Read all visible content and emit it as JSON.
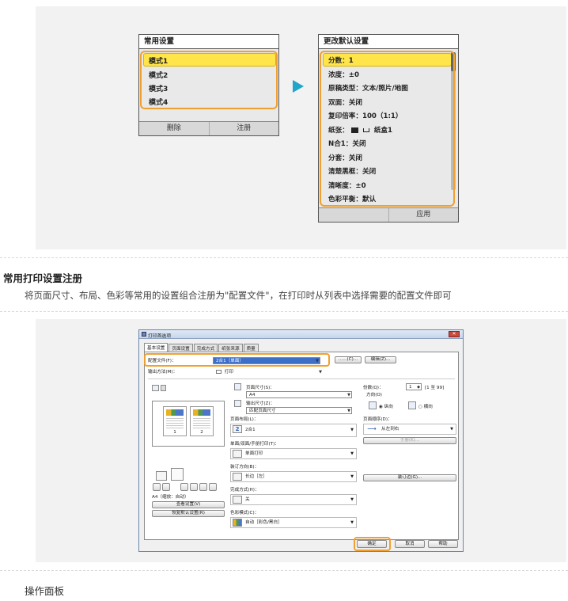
{
  "favorites_screen": {
    "title": "常用设置",
    "items": [
      "模式1",
      "模式2",
      "模式3",
      "模式4"
    ],
    "delete_label": "删除",
    "register_label": "注册"
  },
  "defaults_screen": {
    "title": "更改默认设置",
    "items": [
      "分数：1",
      "浓度：±0",
      "原稿类型：文本/照片/地图",
      "双面：关闭",
      "复印倍率：100（1:1）",
      "纸张：",
      "N合1：关闭",
      "分套：关闭",
      "清楚黑框：关闭",
      "清晰度：±0",
      "色彩平衡：默认"
    ],
    "paper_suffix": "纸盒1",
    "apply_label": "应用"
  },
  "section": {
    "heading": "常用打印设置注册",
    "description": "将页面尺寸、布局、色彩等常用的设置组合注册为\"配置文件\"，在打印时从列表中选择需要的配置文件即可"
  },
  "dialog": {
    "title": "打印首选项",
    "close_glyph": "✕",
    "tabs": [
      "基本设置",
      "页面设置",
      "完成方式",
      "纸张来源",
      "质量"
    ],
    "profile_label": "配置文件(F)：",
    "profile_value": "2合1（单面）",
    "add_button": "......(C)...",
    "edit_button": "编辑(Z)...",
    "output_label": "输出方法(M)：",
    "output_value": "打印",
    "page_size_label": "页面尺寸(S)：",
    "page_size_value": "A4",
    "output_size_label": "输出尺寸(Z)：",
    "output_size_value": "匹配页面尺寸",
    "copies_label": "份数(Q)：",
    "copies_value": "1",
    "copies_range": "[1 至 99]",
    "orientation_label": "方向(O)",
    "portrait_label": "纵向",
    "landscape_label": "横向",
    "layout_label": "页面布局(L)：",
    "layout_value": "2合1",
    "page_order_label": "页面顺序(D)：",
    "page_order_value": "从左到右",
    "manual_button": "手册(K)...",
    "duplex_label": "单面/双面/手册打印(T)：",
    "duplex_value": "单面打印",
    "binding_label": "装订方向(B)：",
    "binding_value": "长边［左］",
    "gutter_button": "装订边(G)...",
    "finishing_label": "完成方式(H)：",
    "finishing_value": "关",
    "color_label": "色彩模式(C)：",
    "color_value": "自动［彩色/黑白］",
    "preview_caption": "A4（缩放：自动）",
    "preview_page1": "1",
    "preview_page2": "2",
    "view_settings_button": "查看设置(V)",
    "restore_defaults_button": "恢复默认设置(R)",
    "ok_button": "确定",
    "cancel_button": "取消",
    "help_button": "帮助"
  },
  "bottom_heading": "操作面板",
  "colors": {
    "accent": "#f0a030",
    "arrow": "#1fa6c8",
    "highlight": "#ffe44a"
  }
}
